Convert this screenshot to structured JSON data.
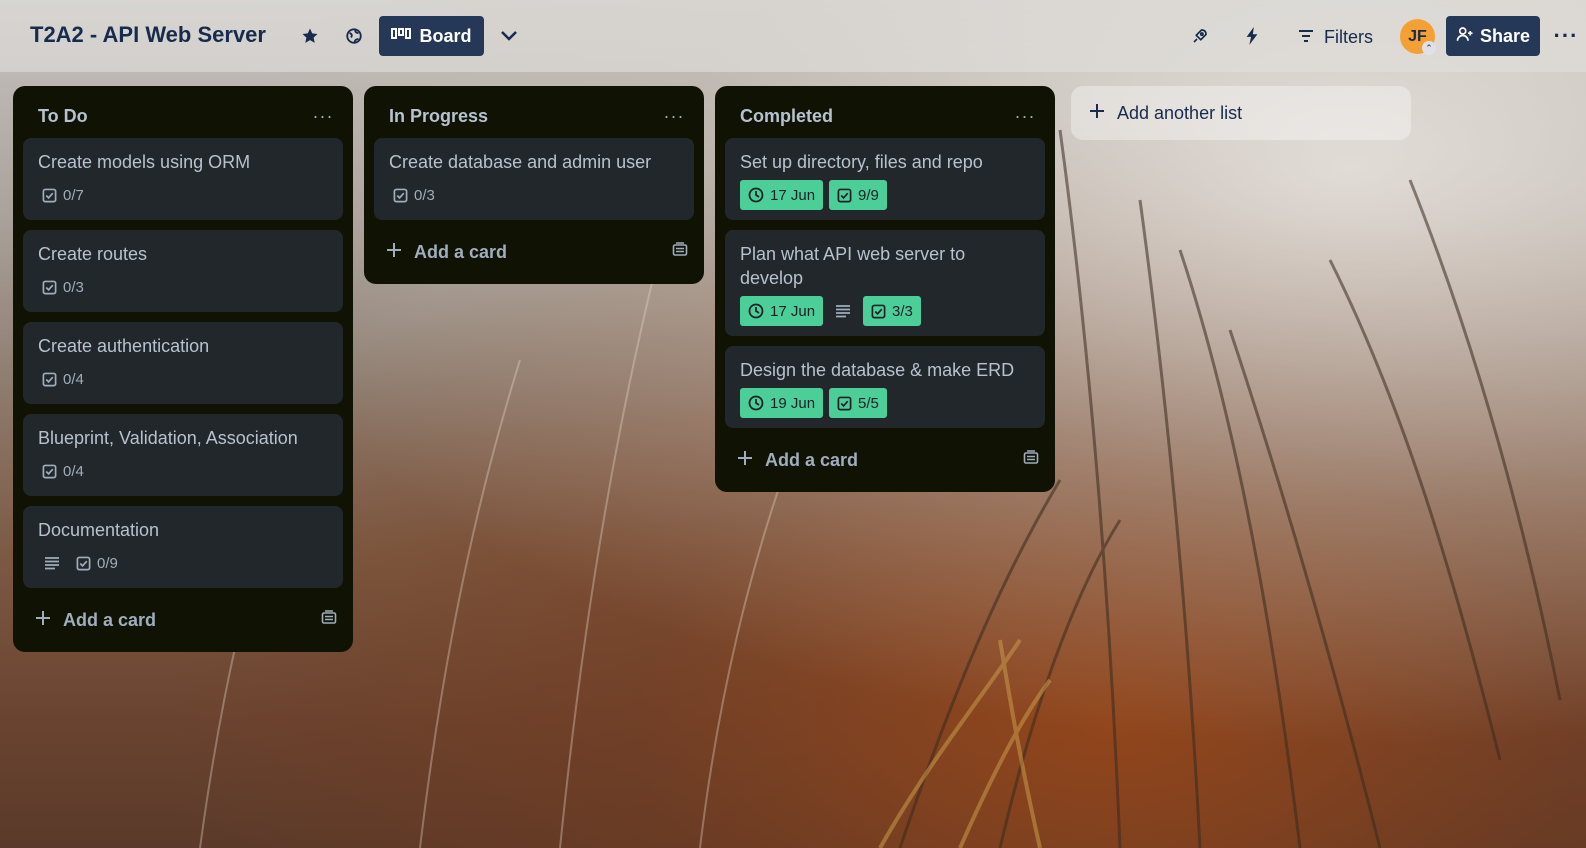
{
  "header": {
    "board_title": "T2A2 - API Web Server",
    "view_label": "Board",
    "filters_label": "Filters",
    "avatar_initials": "JF",
    "share_label": "Share"
  },
  "lists": [
    {
      "title": "To Do",
      "cards": [
        {
          "title": "Create models using ORM",
          "checklist": "0/7"
        },
        {
          "title": "Create routes",
          "checklist": "0/3"
        },
        {
          "title": "Create authentication",
          "checklist": "0/4"
        },
        {
          "title": "Blueprint, Validation, Association",
          "checklist": "0/4"
        },
        {
          "title": "Documentation",
          "checklist": "0/9",
          "has_description": true
        }
      ],
      "add_card_label": "Add a card"
    },
    {
      "title": "In Progress",
      "cards": [
        {
          "title": "Create database and admin user",
          "checklist": "0/3"
        }
      ],
      "add_card_label": "Add a card"
    },
    {
      "title": "Completed",
      "cards": [
        {
          "title": "Set up directory, files and repo",
          "due": "17 Jun",
          "checklist": "9/9"
        },
        {
          "title": "Plan what API web server to develop",
          "due": "17 Jun",
          "checklist": "3/3",
          "has_description": true
        },
        {
          "title": "Design the database & make ERD",
          "due": "19 Jun",
          "checklist": "5/5"
        }
      ],
      "add_card_label": "Add a card"
    }
  ],
  "add_list_label": "Add another list",
  "colors": {
    "header_button": "#253858",
    "list_bg": "#101204",
    "card_bg": "#22272b",
    "complete_badge": "#4bce97",
    "avatar": "#f5a035"
  }
}
